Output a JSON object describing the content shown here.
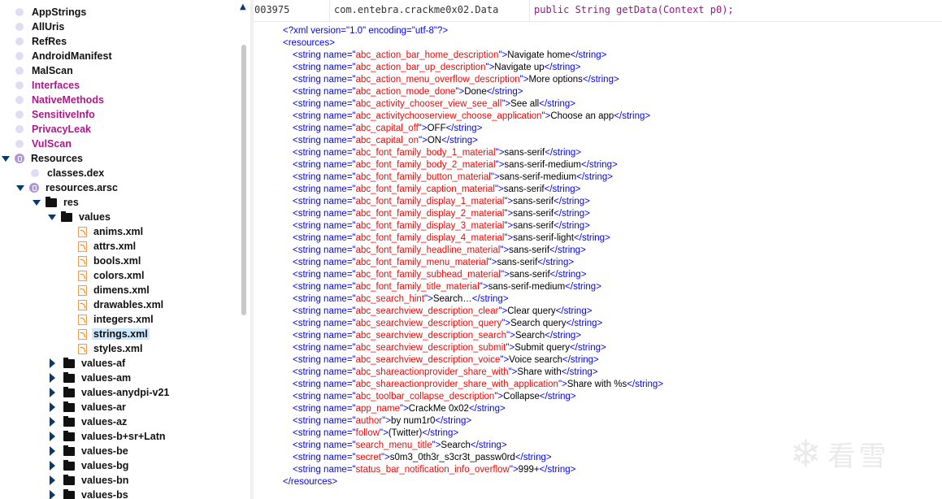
{
  "tree": [
    {
      "label": "AppStrings",
      "kind": "dot",
      "indent": 0,
      "style": "normal"
    },
    {
      "label": "AllUris",
      "kind": "dot",
      "indent": 0,
      "style": "normal"
    },
    {
      "label": "RefRes",
      "kind": "dot",
      "indent": 0,
      "style": "normal"
    },
    {
      "label": "AndroidManifest",
      "kind": "dot",
      "indent": 0,
      "style": "normal"
    },
    {
      "label": "MalScan",
      "kind": "dot",
      "indent": 0,
      "style": "normal"
    },
    {
      "label": "Interfaces",
      "kind": "dot",
      "indent": 0,
      "style": "purple"
    },
    {
      "label": "NativeMethods",
      "kind": "dot",
      "indent": 0,
      "style": "purple"
    },
    {
      "label": "SensitiveInfo",
      "kind": "dot",
      "indent": 0,
      "style": "purple"
    },
    {
      "label": "PrivacyLeak",
      "kind": "dot",
      "indent": 0,
      "style": "purple"
    },
    {
      "label": "VulScan",
      "kind": "dot",
      "indent": 0,
      "style": "purple"
    },
    {
      "label": "Resources",
      "kind": "pkg-expanded",
      "indent": 0,
      "style": "normal"
    },
    {
      "label": "classes.dex",
      "kind": "dot",
      "indent": 1,
      "style": "normal"
    },
    {
      "label": "resources.arsc",
      "kind": "pkg-expanded",
      "indent": 1,
      "style": "normal"
    },
    {
      "label": "res",
      "kind": "folder-expanded",
      "indent": 2,
      "style": "normal"
    },
    {
      "label": "values",
      "kind": "folder-expanded",
      "indent": 3,
      "style": "normal"
    },
    {
      "label": "anims.xml",
      "kind": "xml",
      "indent": 4,
      "style": "normal"
    },
    {
      "label": "attrs.xml",
      "kind": "xml",
      "indent": 4,
      "style": "normal"
    },
    {
      "label": "bools.xml",
      "kind": "xml",
      "indent": 4,
      "style": "normal"
    },
    {
      "label": "colors.xml",
      "kind": "xml",
      "indent": 4,
      "style": "normal"
    },
    {
      "label": "dimens.xml",
      "kind": "xml",
      "indent": 4,
      "style": "normal"
    },
    {
      "label": "drawables.xml",
      "kind": "xml",
      "indent": 4,
      "style": "normal"
    },
    {
      "label": "integers.xml",
      "kind": "xml",
      "indent": 4,
      "style": "normal"
    },
    {
      "label": "strings.xml",
      "kind": "xml",
      "indent": 4,
      "style": "selected"
    },
    {
      "label": "styles.xml",
      "kind": "xml",
      "indent": 4,
      "style": "normal"
    },
    {
      "label": "values-af",
      "kind": "folder-collapsed",
      "indent": 3,
      "style": "normal"
    },
    {
      "label": "values-am",
      "kind": "folder-collapsed",
      "indent": 3,
      "style": "normal"
    },
    {
      "label": "values-anydpi-v21",
      "kind": "folder-collapsed",
      "indent": 3,
      "style": "normal"
    },
    {
      "label": "values-ar",
      "kind": "folder-collapsed",
      "indent": 3,
      "style": "normal"
    },
    {
      "label": "values-az",
      "kind": "folder-collapsed",
      "indent": 3,
      "style": "normal"
    },
    {
      "label": "values-b+sr+Latn",
      "kind": "folder-collapsed",
      "indent": 3,
      "style": "normal"
    },
    {
      "label": "values-be",
      "kind": "folder-collapsed",
      "indent": 3,
      "style": "normal"
    },
    {
      "label": "values-bg",
      "kind": "folder-collapsed",
      "indent": 3,
      "style": "normal"
    },
    {
      "label": "values-bn",
      "kind": "folder-collapsed",
      "indent": 3,
      "style": "normal"
    },
    {
      "label": "values-bs",
      "kind": "folder-collapsed",
      "indent": 3,
      "style": "normal"
    }
  ],
  "search_result": {
    "address": "003975",
    "class_name": "com.entebra.crackme0x02.Data",
    "signature": "public String getData(Context p0);"
  },
  "xml": {
    "declaration": {
      "version": "1.0",
      "encoding": "utf-8"
    },
    "root_open": "<resources>",
    "root_close": "</resources>",
    "strings": [
      {
        "name": "abc_action_bar_home_description",
        "value": "Navigate home"
      },
      {
        "name": "abc_action_bar_up_description",
        "value": "Navigate up"
      },
      {
        "name": "abc_action_menu_overflow_description",
        "value": "More options"
      },
      {
        "name": "abc_action_mode_done",
        "value": "Done"
      },
      {
        "name": "abc_activity_chooser_view_see_all",
        "value": "See all"
      },
      {
        "name": "abc_activitychooserview_choose_application",
        "value": "Choose an app"
      },
      {
        "name": "abc_capital_off",
        "value": "OFF"
      },
      {
        "name": "abc_capital_on",
        "value": "ON"
      },
      {
        "name": "abc_font_family_body_1_material",
        "value": "sans-serif"
      },
      {
        "name": "abc_font_family_body_2_material",
        "value": "sans-serif-medium"
      },
      {
        "name": "abc_font_family_button_material",
        "value": "sans-serif-medium"
      },
      {
        "name": "abc_font_family_caption_material",
        "value": "sans-serif"
      },
      {
        "name": "abc_font_family_display_1_material",
        "value": "sans-serif"
      },
      {
        "name": "abc_font_family_display_2_material",
        "value": "sans-serif"
      },
      {
        "name": "abc_font_family_display_3_material",
        "value": "sans-serif"
      },
      {
        "name": "abc_font_family_display_4_material",
        "value": "sans-serif-light"
      },
      {
        "name": "abc_font_family_headline_material",
        "value": "sans-serif"
      },
      {
        "name": "abc_font_family_menu_material",
        "value": "sans-serif"
      },
      {
        "name": "abc_font_family_subhead_material",
        "value": "sans-serif"
      },
      {
        "name": "abc_font_family_title_material",
        "value": "sans-serif-medium"
      },
      {
        "name": "abc_search_hint",
        "value": "Search…"
      },
      {
        "name": "abc_searchview_description_clear",
        "value": "Clear query"
      },
      {
        "name": "abc_searchview_description_query",
        "value": "Search query"
      },
      {
        "name": "abc_searchview_description_search",
        "value": "Search"
      },
      {
        "name": "abc_searchview_description_submit",
        "value": "Submit query"
      },
      {
        "name": "abc_searchview_description_voice",
        "value": "Voice search"
      },
      {
        "name": "abc_shareactionprovider_share_with",
        "value": "Share with"
      },
      {
        "name": "abc_shareactionprovider_share_with_application",
        "value": "Share with %s"
      },
      {
        "name": "abc_toolbar_collapse_description",
        "value": "Collapse"
      },
      {
        "name": "app_name",
        "value": "CrackMe 0x02"
      },
      {
        "name": "author",
        "value": "by num1r0"
      },
      {
        "name": "follow",
        "value": "(Twitter)"
      },
      {
        "name": "search_menu_title",
        "value": "Search"
      },
      {
        "name": "secret",
        "value": "s0m3_0th3r_s3cr3t_passw0rd"
      },
      {
        "name": "status_bar_notification_info_overflow",
        "value": "999+"
      }
    ]
  },
  "watermark": {
    "text": "看雪",
    "icon": "snowflake-icon"
  },
  "colors": {
    "tag": "#0000ff",
    "attr": "#ff0000",
    "selection": "#cce8ff",
    "purple_label": "#b0178a"
  }
}
